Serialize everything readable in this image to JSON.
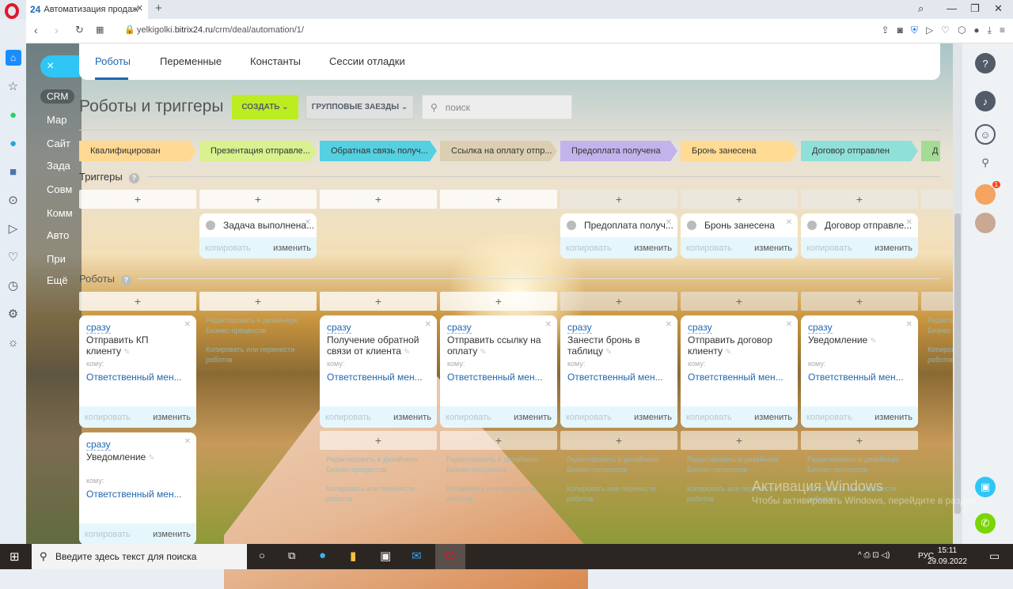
{
  "browser": {
    "tab_title": "Автоматизация продаж",
    "tab_logo": "24",
    "url_prefix": "yelkigolki.",
    "url_domain": "bitrix24.ru",
    "url_path": "/crm/deal/automation/1/"
  },
  "left_menu": {
    "close": "×",
    "crm": "CRM",
    "items": [
      "Мар",
      "Сайт",
      "Зада",
      "Совм",
      "Комм",
      "Авто",
      "При",
      "Ещё"
    ]
  },
  "tabs": [
    "Роботы",
    "Переменные",
    "Константы",
    "Сессии отладки"
  ],
  "page_title": "Роботы и триггеры",
  "toolbar": {
    "create": "СОЗДАТЬ",
    "group": "ГРУППОВЫЕ ЗАЕЗДЫ",
    "search_placeholder": "поиск"
  },
  "stages": [
    {
      "name": "Квалифицирован",
      "color": "#ffd993"
    },
    {
      "name": "Презентация отправле...",
      "color": "#d9f18e"
    },
    {
      "name": "Обратная связь получ...",
      "color": "#55d0e0"
    },
    {
      "name": "Ссылка на оплату отпр...",
      "color": "#dccfb1"
    },
    {
      "name": "Предоплата получена",
      "color": "#c2b3ec"
    },
    {
      "name": "Бронь занесена",
      "color": "#ffdb93"
    },
    {
      "name": "Договор отправлен",
      "color": "#8fe0d8"
    },
    {
      "name": "Д",
      "color": "#a5dc95"
    }
  ],
  "triggers_heading": "Триггеры",
  "robots_heading": "Роботы",
  "help": "?",
  "plus": "+",
  "copy": "копировать",
  "edit": "изменить",
  "when": "сразу",
  "to": "кому:",
  "responsible": "Ответственный мен...",
  "triggers": [
    null,
    "Задача выполнена...",
    null,
    null,
    "Предоплата получ...",
    "Бронь занесена",
    "Договор отправле...",
    null
  ],
  "robots": [
    [
      "Отправить КП клиенту",
      "Уведомление"
    ],
    [],
    [
      "Получение обратной связи от клиента"
    ],
    [
      "Отправить ссылку на оплату"
    ],
    [
      "Занести бронь в таблицу"
    ],
    [
      "Отправить договор клиенту"
    ],
    [
      "Уведомление"
    ],
    []
  ],
  "links": {
    "designer": "Редактировать в дизайнере Бизнес-процессов",
    "copy_move": "Копировать или перенести роботов"
  },
  "watermark": {
    "title": "Активация Windows",
    "sub": "Чтобы активировать Windows, перейдите в раздел"
  },
  "taskbar": {
    "search": "Введите здесь текст для поиска",
    "lang": "РУС",
    "time": "15:11",
    "date": "29.09.2022"
  },
  "notifications_badge": "1"
}
